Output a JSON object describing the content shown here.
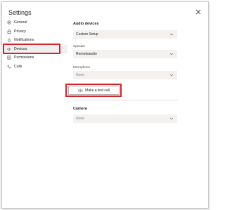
{
  "dialog": {
    "title": "Settings",
    "close_icon": "close-icon"
  },
  "sidebar": {
    "items": [
      {
        "label": "General",
        "icon": "gear-icon"
      },
      {
        "label": "Privacy",
        "icon": "lock-icon"
      },
      {
        "label": "Notifications",
        "icon": "bell-icon"
      },
      {
        "label": "Devices",
        "icon": "speaker-icon",
        "active": true
      },
      {
        "label": "Permissions",
        "icon": "permissions-grid-icon"
      },
      {
        "label": "Calls",
        "icon": "phone-icon"
      }
    ]
  },
  "audio": {
    "section_title": "Audio devices",
    "device_value": "Custom Setup",
    "speaker_label": "Speaker",
    "speaker_value": "Remoteaudio",
    "microphone_label": "Microphone",
    "microphone_value": "None",
    "test_call_label": "Make a test call"
  },
  "camera": {
    "section_title": "Camera",
    "camera_value": "None"
  },
  "colors": {
    "highlight": "#d9222a",
    "select_bg": "#f3f2f1",
    "active_bg": "#f0f0f0"
  }
}
